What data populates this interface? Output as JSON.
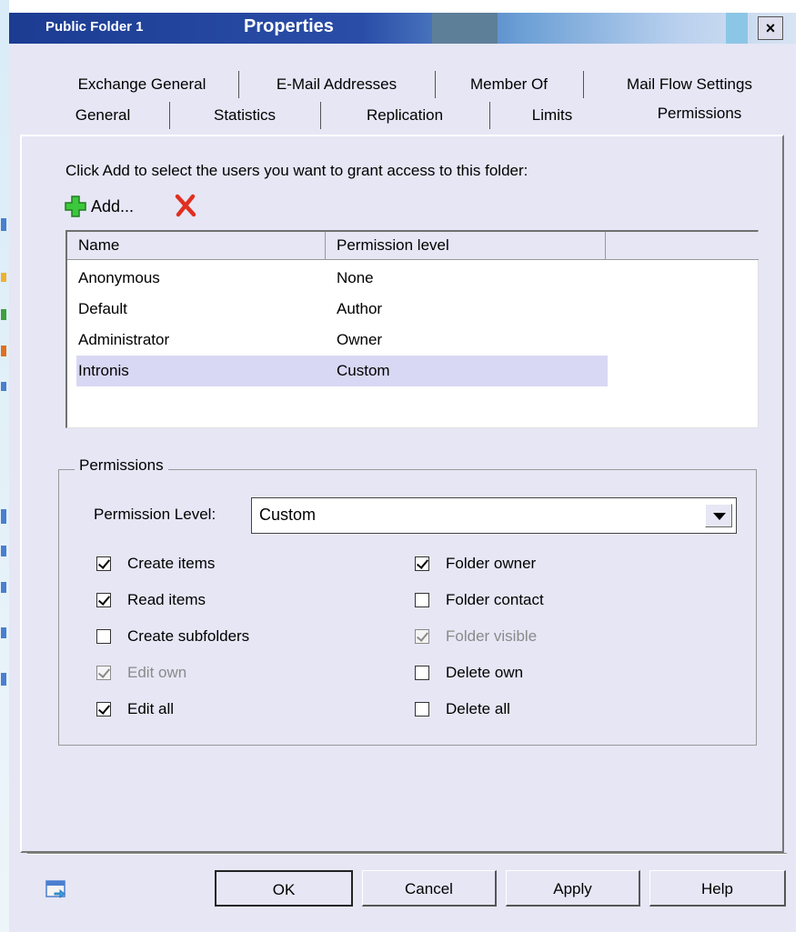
{
  "window": {
    "folder_name": "Public Folder 1",
    "title": "Properties",
    "close_label": "×"
  },
  "tabs": {
    "row1": [
      "Exchange General",
      "E-Mail Addresses",
      "Member Of",
      "Mail Flow Settings"
    ],
    "row2": [
      "General",
      "Statistics",
      "Replication",
      "Limits",
      "Permissions"
    ],
    "active": "Permissions"
  },
  "permissions_page": {
    "instruction": "Click Add to select the users you want to grant access to this folder:",
    "add_label": "Add...",
    "columns": [
      "Name",
      "Permission level"
    ],
    "rows": [
      {
        "name": "Anonymous",
        "level": "None"
      },
      {
        "name": "Default",
        "level": "Author"
      },
      {
        "name": "Administrator",
        "level": "Owner"
      },
      {
        "name": "Intronis",
        "level": "Custom"
      }
    ],
    "selected_row": "Intronis"
  },
  "permissions_group": {
    "label": "Permissions",
    "level_label": "Permission Level:",
    "level_value": "Custom",
    "left_checks": [
      {
        "label": "Create items",
        "checked": true,
        "disabled": false
      },
      {
        "label": "Read items",
        "checked": true,
        "disabled": false
      },
      {
        "label": "Create subfolders",
        "checked": false,
        "disabled": false
      },
      {
        "label": "Edit own",
        "checked": true,
        "disabled": true
      },
      {
        "label": "Edit all",
        "checked": true,
        "disabled": false
      }
    ],
    "right_checks": [
      {
        "label": "Folder owner",
        "checked": true,
        "disabled": false
      },
      {
        "label": "Folder contact",
        "checked": false,
        "disabled": false
      },
      {
        "label": "Folder visible",
        "checked": true,
        "disabled": true
      },
      {
        "label": "Delete own",
        "checked": false,
        "disabled": false
      },
      {
        "label": "Delete all",
        "checked": false,
        "disabled": false
      }
    ]
  },
  "buttons": {
    "ok": "OK",
    "cancel": "Cancel",
    "apply": "Apply",
    "help": "Help"
  },
  "colors": {
    "dialog_bg": "#e6e6f5",
    "title_blue": "#1c3c92",
    "selection": "#d8d8f4",
    "add_green": "#3cc83c",
    "remove_red": "#e03020"
  }
}
